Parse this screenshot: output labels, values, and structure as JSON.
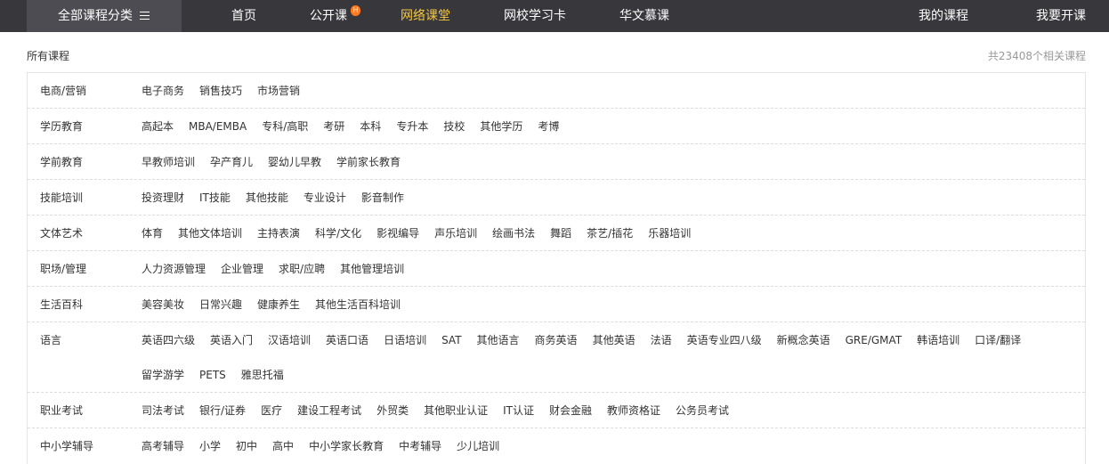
{
  "nav": {
    "category_button": "全部课程分类",
    "items": [
      "首页",
      "公开课",
      "网络课堂",
      "网校学习卡",
      "华文慕课"
    ],
    "hot_badge": "H",
    "right": [
      "我的课程",
      "我要开课"
    ]
  },
  "header": {
    "breadcrumb": "所有课程",
    "total": "共23408个相关课程"
  },
  "categories": [
    {
      "label": "电商/营销",
      "items": [
        "电子商务",
        "销售技巧",
        "市场营销"
      ]
    },
    {
      "label": "学历教育",
      "items": [
        "高起本",
        "MBA/EMBA",
        "专科/高职",
        "考研",
        "本科",
        "专升本",
        "技校",
        "其他学历",
        "考博"
      ]
    },
    {
      "label": "学前教育",
      "items": [
        "早教师培训",
        "孕产育儿",
        "婴幼儿早教",
        "学前家长教育"
      ]
    },
    {
      "label": "技能培训",
      "items": [
        "投资理财",
        "IT技能",
        "其他技能",
        "专业设计",
        "影音制作"
      ]
    },
    {
      "label": "文体艺术",
      "items": [
        "体育",
        "其他文体培训",
        "主持表演",
        "科学/文化",
        "影视编导",
        "声乐培训",
        "绘画书法",
        "舞蹈",
        "茶艺/插花",
        "乐器培训"
      ]
    },
    {
      "label": "职场/管理",
      "items": [
        "人力资源管理",
        "企业管理",
        "求职/应聘",
        "其他管理培训"
      ]
    },
    {
      "label": "生活百科",
      "items": [
        "美容美妆",
        "日常兴趣",
        "健康养生",
        "其他生活百科培训"
      ]
    },
    {
      "label": "语言",
      "items": [
        "英语四六级",
        "英语入门",
        "汉语培训",
        "英语口语",
        "日语培训",
        "SAT",
        "其他语言",
        "商务英语",
        "其他英语",
        "法语",
        "英语专业四八级",
        "新概念英语",
        "GRE/GMAT",
        "韩语培训",
        "口译/翻译",
        "留学游学",
        "PETS",
        "雅思托福"
      ]
    },
    {
      "label": "职业考试",
      "items": [
        "司法考试",
        "银行/证券",
        "医疗",
        "建设工程考试",
        "外贸类",
        "其他职业认证",
        "IT认证",
        "财会金融",
        "教师资格证",
        "公务员考试"
      ]
    },
    {
      "label": "中小学辅导",
      "items": [
        "高考辅导",
        "小学",
        "初中",
        "高中",
        "中小学家长教育",
        "中考辅导",
        "少儿培训"
      ]
    }
  ]
}
